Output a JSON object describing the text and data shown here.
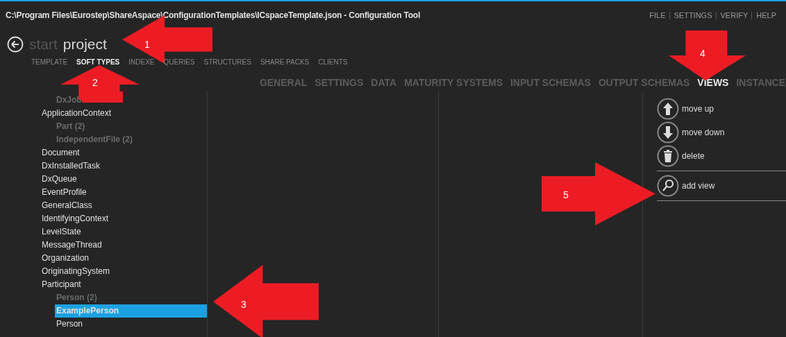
{
  "window": {
    "title": "C:\\Program Files\\Eurostep\\ShareAspace\\ConfigurationTemplates\\ICspaceTemplate.json - Configuration Tool"
  },
  "menu": [
    "FILE",
    "SETTINGS",
    "VERIFY",
    "HELP"
  ],
  "breadcrumb": [
    {
      "label": "start",
      "selected": false
    },
    {
      "label": "project",
      "selected": true
    }
  ],
  "tabs": [
    {
      "label": "TEMPLATE",
      "selected": false
    },
    {
      "label": "SOFT TYPES",
      "selected": true
    },
    {
      "label": "INDEXE",
      "selected": false
    },
    {
      "label": "QUERIES",
      "selected": false
    },
    {
      "label": "STRUCTURES",
      "selected": false
    },
    {
      "label": "SHARE PACKS",
      "selected": false
    },
    {
      "label": "CLIENTS",
      "selected": false
    }
  ],
  "sub_tabs": [
    {
      "label": "GENERAL",
      "selected": false
    },
    {
      "label": "SETTINGS",
      "selected": false
    },
    {
      "label": "DATA",
      "selected": false
    },
    {
      "label": "MATURITY SYSTEMS",
      "selected": false
    },
    {
      "label": "INPUT SCHEMAS",
      "selected": false
    },
    {
      "label": "OUTPUT SCHEMAS",
      "selected": false
    },
    {
      "label": "VIEWS",
      "selected": true
    },
    {
      "label": "INSTANCE",
      "selected": false
    }
  ],
  "tree": [
    {
      "label": "DxJob",
      "kind": "group",
      "redacted": true
    },
    {
      "label": "ApplicationContext",
      "kind": "type"
    },
    {
      "label": "Part (2)",
      "kind": "group"
    },
    {
      "label": "IndependentFile (2)",
      "kind": "group"
    },
    {
      "label": "Document",
      "kind": "type"
    },
    {
      "label": "DxInstalledTask",
      "kind": "type"
    },
    {
      "label": "DxQueue",
      "kind": "type"
    },
    {
      "label": "EventProfile",
      "kind": "type"
    },
    {
      "label": "GeneralClass",
      "kind": "type"
    },
    {
      "label": "IdentifyingContext",
      "kind": "type"
    },
    {
      "label": "LevelState",
      "kind": "type"
    },
    {
      "label": "MessageThread",
      "kind": "type"
    },
    {
      "label": "Organization",
      "kind": "type"
    },
    {
      "label": "OriginatingSystem",
      "kind": "type"
    },
    {
      "label": "Participant",
      "kind": "type"
    },
    {
      "label": "Person (2)",
      "kind": "group",
      "children": [
        {
          "label": "ExamplePerson",
          "selected": true
        },
        {
          "label": "Person",
          "selected": false
        }
      ]
    }
  ],
  "actions": [
    {
      "label": "move up",
      "kind": "up"
    },
    {
      "label": "move down",
      "kind": "down"
    },
    {
      "label": "delete",
      "kind": "delete"
    },
    {
      "label": "add view",
      "kind": "search"
    }
  ],
  "annotations": [
    {
      "number": "1",
      "kind": "left"
    },
    {
      "number": "2",
      "kind": "up"
    },
    {
      "number": "3",
      "kind": "left"
    },
    {
      "number": "4",
      "kind": "down"
    },
    {
      "number": "5",
      "kind": "right"
    }
  ]
}
